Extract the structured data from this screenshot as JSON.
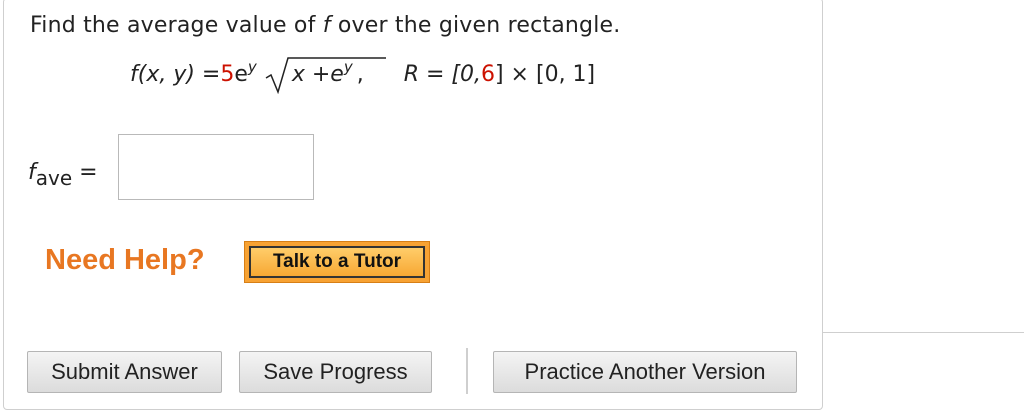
{
  "question": {
    "prefix": "Find the average value of ",
    "var": "f",
    "suffix": " over the given rectangle."
  },
  "formula": {
    "lhs": "f(x, y) = ",
    "coef": "5",
    "base": "e",
    "exp": "y",
    "radicand_x": "x + ",
    "radicand_base": "e",
    "radicand_exp": "y",
    "comma": ",",
    "region_prefix": "R = [0, ",
    "region_highlight": "6",
    "region_suffix": "] × [0, 1]"
  },
  "answer": {
    "label_main": "f",
    "label_sub": "ave",
    "label_eq": " =",
    "value": ""
  },
  "help": {
    "title": "Need Help?",
    "tutor_button": "Talk to a Tutor"
  },
  "buttons": {
    "submit": "Submit Answer",
    "save": "Save Progress",
    "practice": "Practice Another Version"
  },
  "colors": {
    "highlight_red": "#cc1100",
    "help_orange": "#e87722",
    "tutor_button_bg": "#f7a233"
  }
}
